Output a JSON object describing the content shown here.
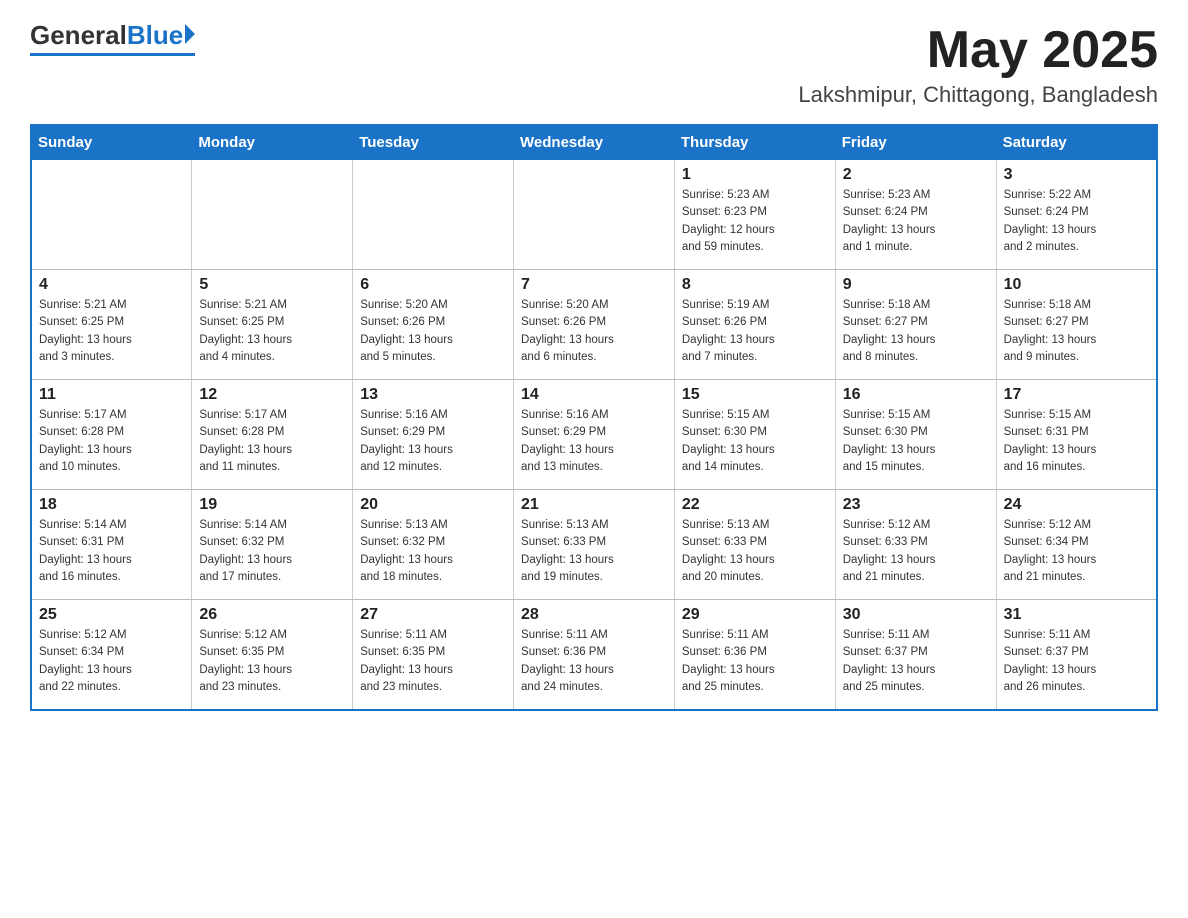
{
  "header": {
    "logo_general": "General",
    "logo_blue": "Blue",
    "month_title": "May 2025",
    "location": "Lakshmipur, Chittagong, Bangladesh"
  },
  "days_of_week": [
    "Sunday",
    "Monday",
    "Tuesday",
    "Wednesday",
    "Thursday",
    "Friday",
    "Saturday"
  ],
  "weeks": [
    [
      {
        "day": "",
        "info": ""
      },
      {
        "day": "",
        "info": ""
      },
      {
        "day": "",
        "info": ""
      },
      {
        "day": "",
        "info": ""
      },
      {
        "day": "1",
        "info": "Sunrise: 5:23 AM\nSunset: 6:23 PM\nDaylight: 12 hours\nand 59 minutes."
      },
      {
        "day": "2",
        "info": "Sunrise: 5:23 AM\nSunset: 6:24 PM\nDaylight: 13 hours\nand 1 minute."
      },
      {
        "day": "3",
        "info": "Sunrise: 5:22 AM\nSunset: 6:24 PM\nDaylight: 13 hours\nand 2 minutes."
      }
    ],
    [
      {
        "day": "4",
        "info": "Sunrise: 5:21 AM\nSunset: 6:25 PM\nDaylight: 13 hours\nand 3 minutes."
      },
      {
        "day": "5",
        "info": "Sunrise: 5:21 AM\nSunset: 6:25 PM\nDaylight: 13 hours\nand 4 minutes."
      },
      {
        "day": "6",
        "info": "Sunrise: 5:20 AM\nSunset: 6:26 PM\nDaylight: 13 hours\nand 5 minutes."
      },
      {
        "day": "7",
        "info": "Sunrise: 5:20 AM\nSunset: 6:26 PM\nDaylight: 13 hours\nand 6 minutes."
      },
      {
        "day": "8",
        "info": "Sunrise: 5:19 AM\nSunset: 6:26 PM\nDaylight: 13 hours\nand 7 minutes."
      },
      {
        "day": "9",
        "info": "Sunrise: 5:18 AM\nSunset: 6:27 PM\nDaylight: 13 hours\nand 8 minutes."
      },
      {
        "day": "10",
        "info": "Sunrise: 5:18 AM\nSunset: 6:27 PM\nDaylight: 13 hours\nand 9 minutes."
      }
    ],
    [
      {
        "day": "11",
        "info": "Sunrise: 5:17 AM\nSunset: 6:28 PM\nDaylight: 13 hours\nand 10 minutes."
      },
      {
        "day": "12",
        "info": "Sunrise: 5:17 AM\nSunset: 6:28 PM\nDaylight: 13 hours\nand 11 minutes."
      },
      {
        "day": "13",
        "info": "Sunrise: 5:16 AM\nSunset: 6:29 PM\nDaylight: 13 hours\nand 12 minutes."
      },
      {
        "day": "14",
        "info": "Sunrise: 5:16 AM\nSunset: 6:29 PM\nDaylight: 13 hours\nand 13 minutes."
      },
      {
        "day": "15",
        "info": "Sunrise: 5:15 AM\nSunset: 6:30 PM\nDaylight: 13 hours\nand 14 minutes."
      },
      {
        "day": "16",
        "info": "Sunrise: 5:15 AM\nSunset: 6:30 PM\nDaylight: 13 hours\nand 15 minutes."
      },
      {
        "day": "17",
        "info": "Sunrise: 5:15 AM\nSunset: 6:31 PM\nDaylight: 13 hours\nand 16 minutes."
      }
    ],
    [
      {
        "day": "18",
        "info": "Sunrise: 5:14 AM\nSunset: 6:31 PM\nDaylight: 13 hours\nand 16 minutes."
      },
      {
        "day": "19",
        "info": "Sunrise: 5:14 AM\nSunset: 6:32 PM\nDaylight: 13 hours\nand 17 minutes."
      },
      {
        "day": "20",
        "info": "Sunrise: 5:13 AM\nSunset: 6:32 PM\nDaylight: 13 hours\nand 18 minutes."
      },
      {
        "day": "21",
        "info": "Sunrise: 5:13 AM\nSunset: 6:33 PM\nDaylight: 13 hours\nand 19 minutes."
      },
      {
        "day": "22",
        "info": "Sunrise: 5:13 AM\nSunset: 6:33 PM\nDaylight: 13 hours\nand 20 minutes."
      },
      {
        "day": "23",
        "info": "Sunrise: 5:12 AM\nSunset: 6:33 PM\nDaylight: 13 hours\nand 21 minutes."
      },
      {
        "day": "24",
        "info": "Sunrise: 5:12 AM\nSunset: 6:34 PM\nDaylight: 13 hours\nand 21 minutes."
      }
    ],
    [
      {
        "day": "25",
        "info": "Sunrise: 5:12 AM\nSunset: 6:34 PM\nDaylight: 13 hours\nand 22 minutes."
      },
      {
        "day": "26",
        "info": "Sunrise: 5:12 AM\nSunset: 6:35 PM\nDaylight: 13 hours\nand 23 minutes."
      },
      {
        "day": "27",
        "info": "Sunrise: 5:11 AM\nSunset: 6:35 PM\nDaylight: 13 hours\nand 23 minutes."
      },
      {
        "day": "28",
        "info": "Sunrise: 5:11 AM\nSunset: 6:36 PM\nDaylight: 13 hours\nand 24 minutes."
      },
      {
        "day": "29",
        "info": "Sunrise: 5:11 AM\nSunset: 6:36 PM\nDaylight: 13 hours\nand 25 minutes."
      },
      {
        "day": "30",
        "info": "Sunrise: 5:11 AM\nSunset: 6:37 PM\nDaylight: 13 hours\nand 25 minutes."
      },
      {
        "day": "31",
        "info": "Sunrise: 5:11 AM\nSunset: 6:37 PM\nDaylight: 13 hours\nand 26 minutes."
      }
    ]
  ]
}
